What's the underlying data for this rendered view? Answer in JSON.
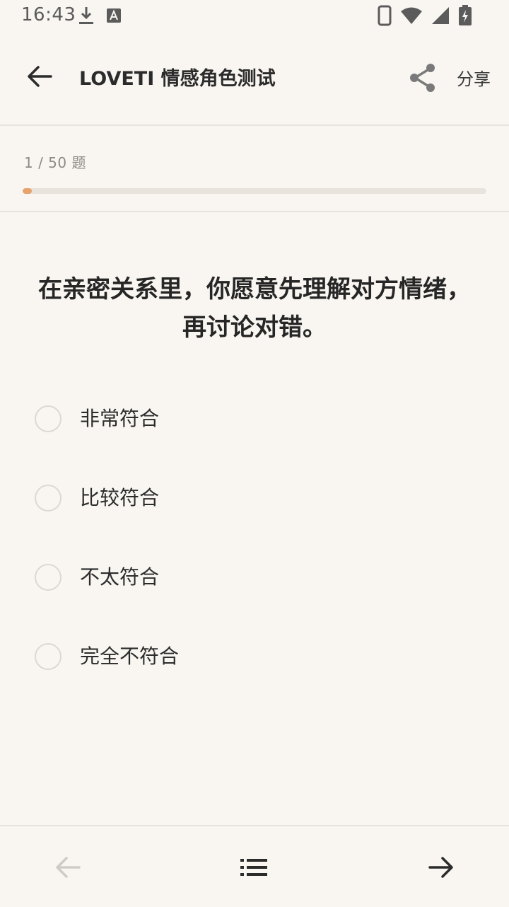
{
  "status_bar": {
    "time": "16:43",
    "left_icons": [
      "download-icon",
      "a-box-icon"
    ],
    "right_icons": [
      "phone-icon",
      "wifi-icon",
      "signal-icon",
      "battery-charging-icon"
    ]
  },
  "app_bar": {
    "title": "LOVETI 情感角色测试",
    "share_label": "分享"
  },
  "progress": {
    "text": "1 / 50 题",
    "current": 1,
    "total": 50,
    "color": "#e7a36c"
  },
  "question": {
    "text": "在亲密关系里，你愿意先理解对方情绪，再讨论对错。"
  },
  "options": [
    {
      "label": "非常符合"
    },
    {
      "label": "比较符合"
    },
    {
      "label": "不太符合"
    },
    {
      "label": "完全不符合"
    }
  ],
  "bottom_nav": {
    "prev_icon": "arrow-left-icon",
    "list_icon": "list-icon",
    "next_icon": "arrow-right-icon"
  },
  "colors": {
    "background": "#f9f6f2",
    "divider": "#e6e2dd",
    "accent": "#e7a36c"
  }
}
